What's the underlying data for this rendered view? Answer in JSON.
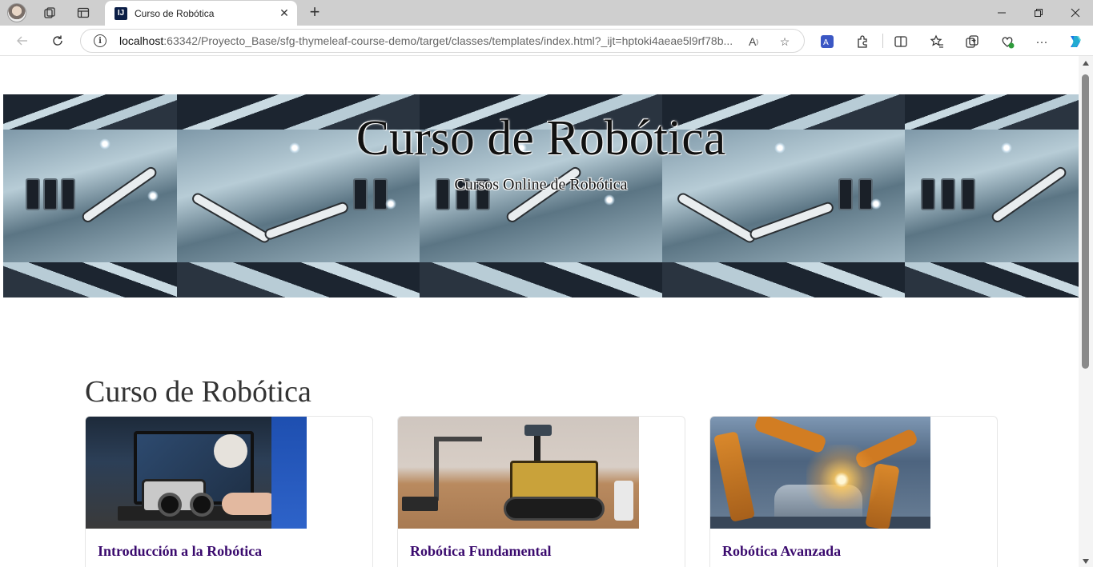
{
  "browser": {
    "tab": {
      "title": "Curso de Robótica",
      "favicon_text": "IJ"
    },
    "address": {
      "url_host": "localhost",
      "url_rest": ":63342/Proyecto_Base/sfg-thymeleaf-course-demo/target/classes/templates/index.html?_ijt=hptoki4aeae5l9rf78b..."
    }
  },
  "page": {
    "hero": {
      "title": "Curso de Robótica",
      "subtitle": "Cursos Online de Robótica"
    },
    "section_title": "Curso de Robótica",
    "cards": [
      {
        "title": "Introducción a la Robótica"
      },
      {
        "title": "Robótica Fundamental"
      },
      {
        "title": "Robótica Avanzada"
      }
    ]
  },
  "colors": {
    "card_title": "#3a0a6e",
    "tab_bar": "#cfcfcf",
    "edge_accent": "#1a73e8"
  }
}
